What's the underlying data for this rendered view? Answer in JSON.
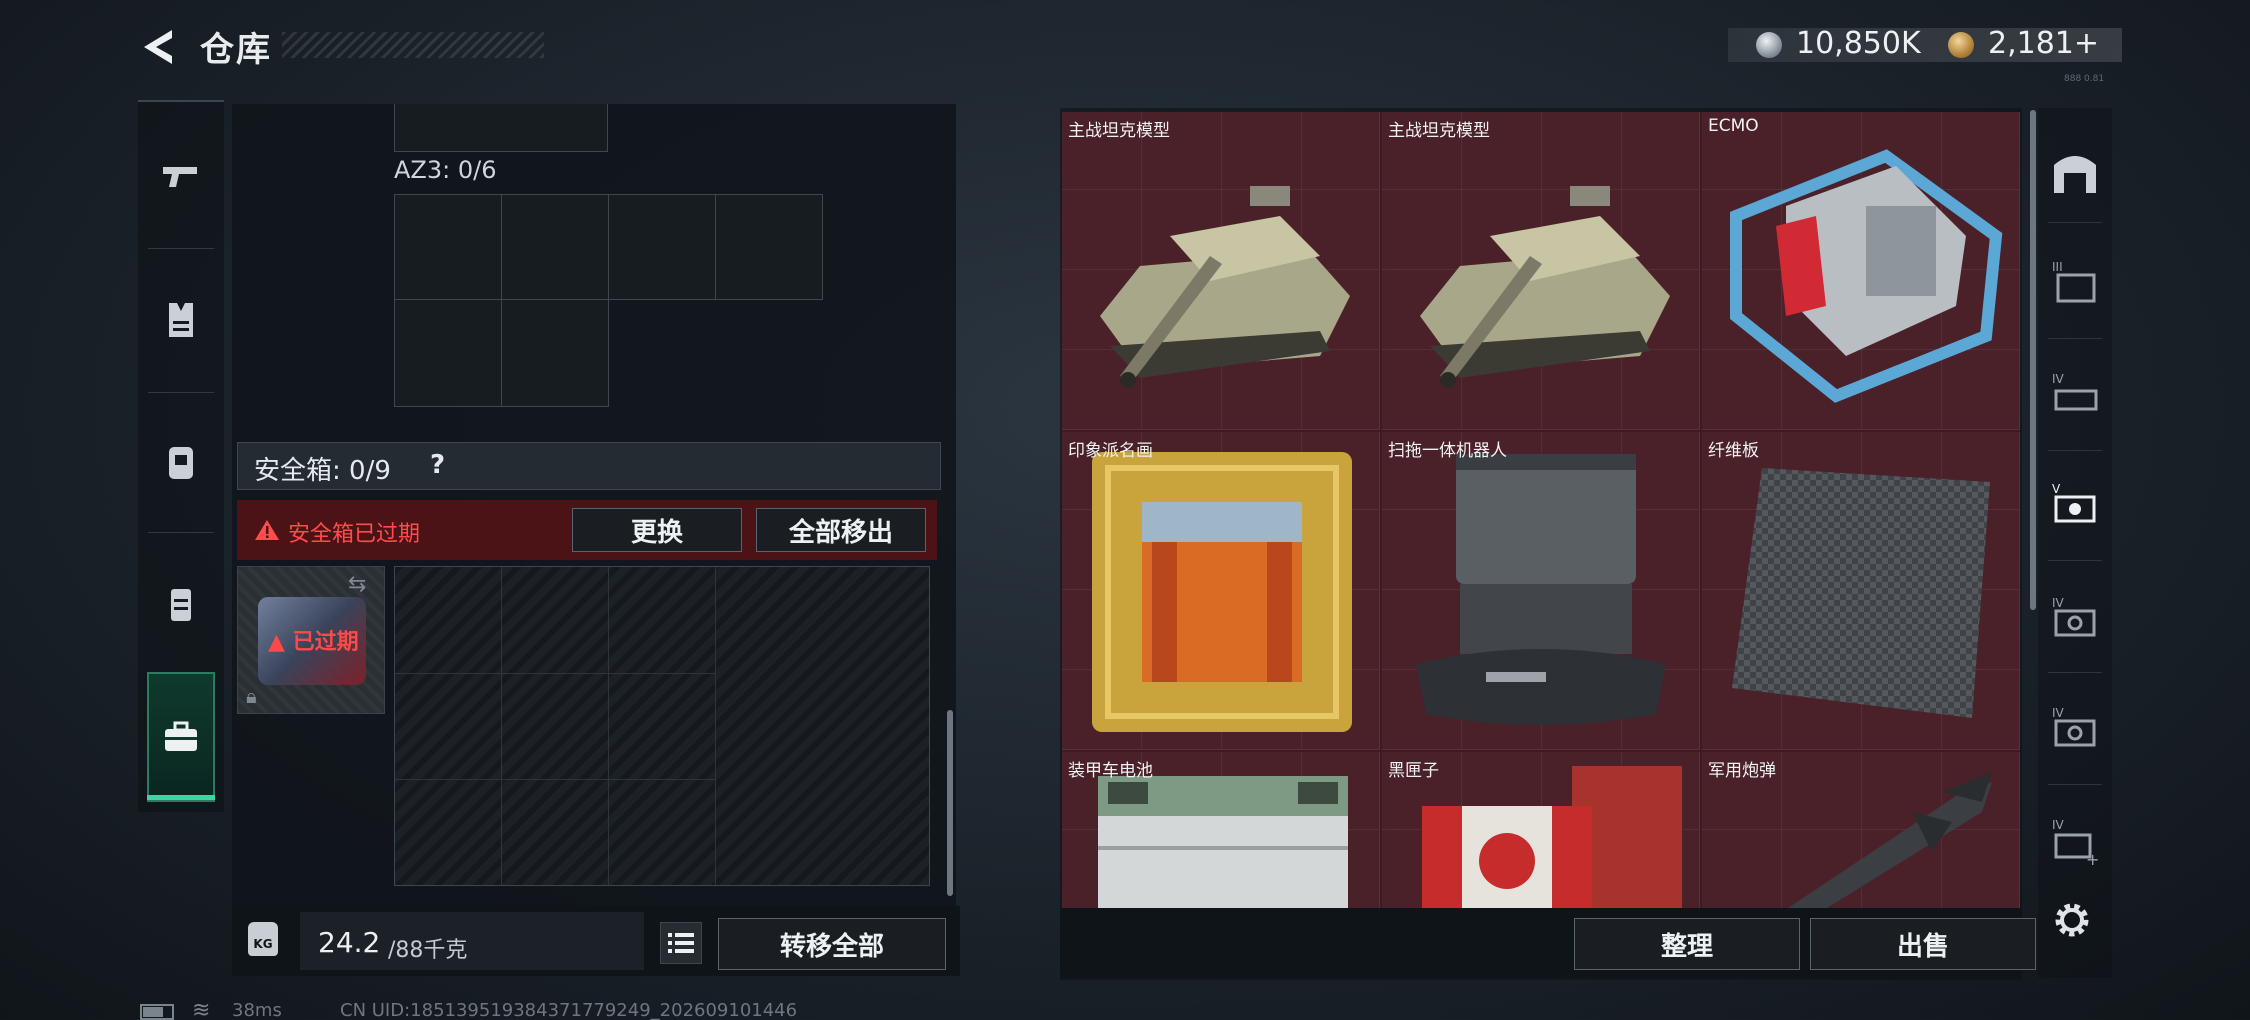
{
  "header": {
    "title": "仓库",
    "currency_silver": "10,850K",
    "currency_gold": "2,181+",
    "version_tiny": "888 0.81"
  },
  "left_panel": {
    "az3_label": "AZ3: 0/6",
    "safebox_title": "安全箱: 0/9",
    "safebox_help": "?",
    "expired_message": "安全箱已过期",
    "replace_button": "更换",
    "move_all_button": "全部移出",
    "expired_badge": "已过期",
    "weight_current": "24.2",
    "weight_total": "/88千克",
    "transfer_all_button": "转移全部",
    "kg_icon_label": "KG"
  },
  "inventory": {
    "items": [
      {
        "name": "主战坦克模型",
        "icon": "tank-model"
      },
      {
        "name": "主战坦克模型",
        "icon": "tank-model"
      },
      {
        "name": "ECMO",
        "icon": "ecmo-machine"
      },
      {
        "name": "印象派名画",
        "icon": "framed-painting"
      },
      {
        "name": "扫拖一体机器人",
        "icon": "robot-vacuum-station"
      },
      {
        "name": "纤维板",
        "icon": "carbon-fiber-board"
      },
      {
        "name": "装甲车电池",
        "icon": "armored-battery"
      },
      {
        "name": "黑匣子",
        "icon": "black-box"
      },
      {
        "name": "军用炮弹",
        "icon": "military-shell"
      }
    ],
    "sort_button": "整理",
    "sell_button": "出售",
    "cell_color": "#4a2129"
  },
  "left_rail": [
    "pistol-icon",
    "vest-icon",
    "backpack-icon",
    "rig-icon",
    "briefcase-icon"
  ],
  "right_rail_tiers": [
    "",
    "III",
    "IV",
    "V",
    "IV",
    "IV",
    "IV"
  ],
  "status": {
    "ping": "38ms",
    "uid": "CN UID:18513951938437177924​9_202609101446"
  }
}
